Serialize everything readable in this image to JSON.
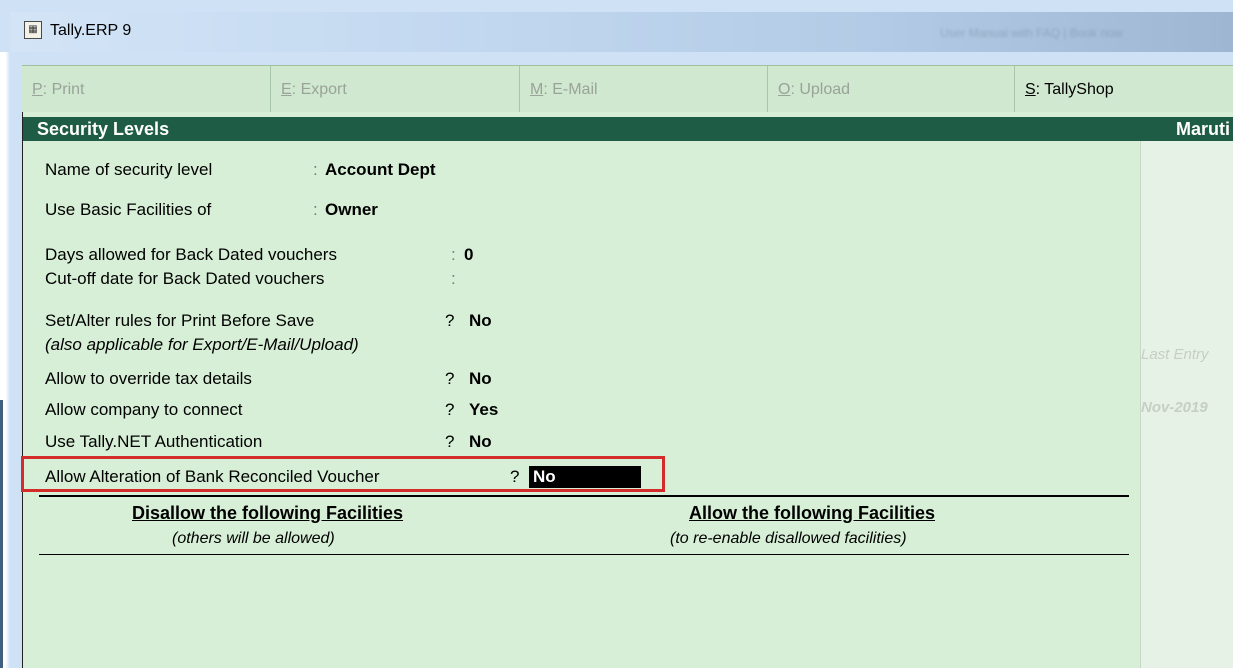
{
  "window": {
    "title": "Tally.ERP 9",
    "caption_blurred": "User Manual with FAQ | Book now"
  },
  "buttonbar": {
    "buttons": [
      {
        "key": "P",
        "label": ": Print"
      },
      {
        "key": "E",
        "label": ": Export"
      },
      {
        "key": "M",
        "label": ": E-Mail"
      },
      {
        "key": "O",
        "label": ": Upload"
      },
      {
        "key": "S",
        "label": ": TallyShop"
      }
    ]
  },
  "form": {
    "title": "Security Levels",
    "company": "Maruti",
    "fields": {
      "name_label": "Name of security level",
      "name_value": "Account Dept",
      "basic_label": "Use Basic Facilities of",
      "basic_value": "Owner",
      "days_label": "Days allowed for Back Dated vouchers",
      "days_value": "0",
      "cutoff_label": "Cut-off date for Back Dated vouchers",
      "cutoff_value": "",
      "print_rules_label": "Set/Alter rules for Print Before Save",
      "print_rules_value": "No",
      "print_rules_note": "(also applicable for Export/E-Mail/Upload)",
      "override_tax_label": "Allow to override tax details",
      "override_tax_value": "No",
      "connect_label": "Allow company to connect",
      "connect_value": "Yes",
      "auth_label": "Use Tally.NET Authentication",
      "auth_value": "No",
      "bank_label": "Allow Alteration of Bank Reconciled Voucher",
      "bank_value": "No"
    },
    "separator_colon": ":",
    "separator_question": "?",
    "facilities": {
      "disallow_title": "Disallow the following Facilities",
      "disallow_sub": "(others will be allowed)",
      "allow_title": "Allow the following Facilities",
      "allow_sub": "(to re-enable disallowed facilities)"
    },
    "side_panel": {
      "last_entry": "Last Entry",
      "date_fragment": "Nov-2019"
    }
  },
  "colors": {
    "header_bar": "#1f5c46",
    "form_background": "#d7efd7",
    "highlight_border": "#d42b2b"
  }
}
